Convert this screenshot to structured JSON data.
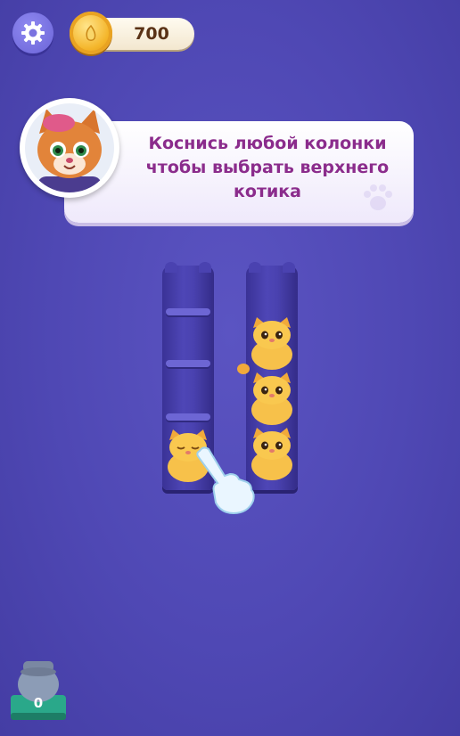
{
  "header": {
    "settings_icon": "gear-icon",
    "coins": "700"
  },
  "tutorial": {
    "character_icon": "red-cat-mascot-icon",
    "message": "Коснись любой колонки чтобы выбрать верхнего котика"
  },
  "board": {
    "columns": [
      {
        "cats": [
          "sleepy-yellow-cat"
        ]
      },
      {
        "cats": [
          "yellow-cat",
          "yellow-cat",
          "yellow-cat"
        ]
      }
    ],
    "hint_icon": "pointing-hand-icon"
  },
  "jar": {
    "count": "0"
  },
  "colors": {
    "background": "#4f48b4",
    "tube": "#4a42b0",
    "cat": "#f7c14a",
    "text_accent": "#8b2c8c"
  }
}
